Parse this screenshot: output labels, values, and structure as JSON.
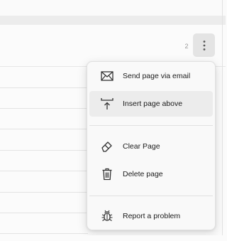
{
  "header": {
    "page_count": "2"
  },
  "menu": {
    "items": [
      {
        "label": "Send page via email",
        "icon": "envelope-icon"
      },
      {
        "label": "Insert page above",
        "icon": "insert-above-icon"
      },
      {
        "label": "Clear Page",
        "icon": "eraser-icon"
      },
      {
        "label": "Delete page",
        "icon": "trash-icon"
      },
      {
        "label": "Report a problem",
        "icon": "bug-icon"
      }
    ]
  },
  "colors": {
    "menu_background": "#f9f9f9",
    "hover_background": "#ececec",
    "button_background": "#e4e4e4"
  }
}
